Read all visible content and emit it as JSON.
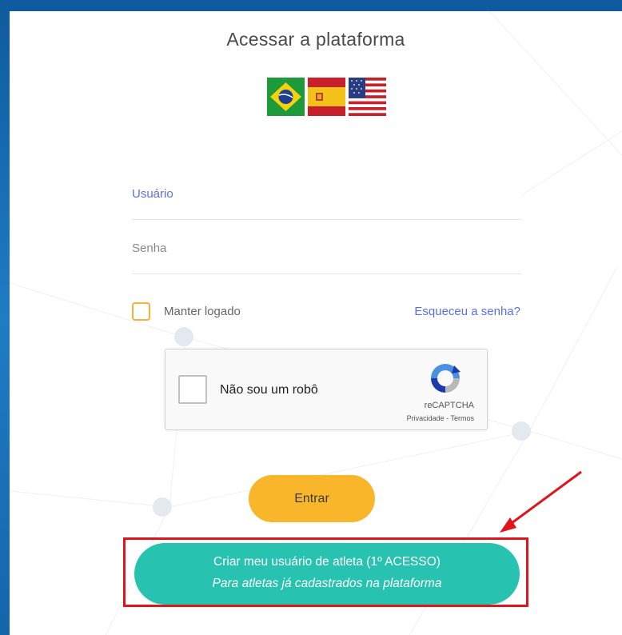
{
  "title": "Acessar a plataforma",
  "languages": [
    "pt-BR",
    "es",
    "en"
  ],
  "form": {
    "username_label": "Usuário",
    "password_label": "Senha",
    "keep_logged_label": "Manter logado",
    "forgot_password": "Esqueceu a senha?"
  },
  "recaptcha": {
    "label": "Não sou um robô",
    "brand": "reCAPTCHA",
    "links": "Privacidade - Termos"
  },
  "buttons": {
    "enter": "Entrar",
    "create_line1": "Criar meu usuário de atleta (1º ACESSO)",
    "create_line2": "Para atletas já cadastrados na plataforma"
  },
  "colors": {
    "accent_blue": "#5b6ee8",
    "enter_yellow": "#f9b62a",
    "create_teal": "#28c3b0",
    "highlight_red": "#e0141b",
    "background_blue": "#1b6fb3"
  }
}
